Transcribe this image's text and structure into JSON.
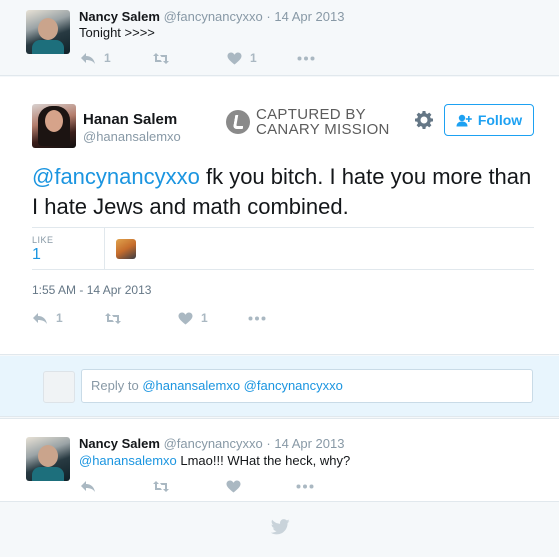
{
  "top_tweet": {
    "name": "Nancy Salem",
    "handle": "@fancynancyxxo",
    "separator": "·",
    "date": "14 Apr 2013",
    "text": "Tonight >>>>",
    "reply_count": "1",
    "like_count": "1"
  },
  "main_tweet": {
    "name": "Hanan Salem",
    "handle": "@hanansalemxo",
    "canary_line1": "CAPTURED BY",
    "canary_line2": "CANARY MISSION",
    "follow_label": "Follow",
    "mention": "@fancynancyxxo",
    "text": " fk you bitch. I hate you more than I hate Jews and math combined.",
    "like_label": "LIKE",
    "like_value": "1",
    "timestamp": "1:55 AM - 14 Apr 2013",
    "reply_count": "1",
    "like_count": "1"
  },
  "reply_composer": {
    "prefix": "Reply to ",
    "mentions": "@hanansalemxo @fancynancyxxo"
  },
  "reply_tweet": {
    "name": "Nancy Salem",
    "handle": "@fancynancyxxo",
    "separator": "·",
    "date": "14 Apr 2013",
    "mention": "@hanansalemxo",
    "text": " Lmao!!! WHat the heck, why?"
  },
  "colors": {
    "accent": "#1da1f2",
    "link": "#1b95e0",
    "muted": "#8899a6",
    "icon": "#aab8c2",
    "canary_gray": "#5c5c5c"
  }
}
